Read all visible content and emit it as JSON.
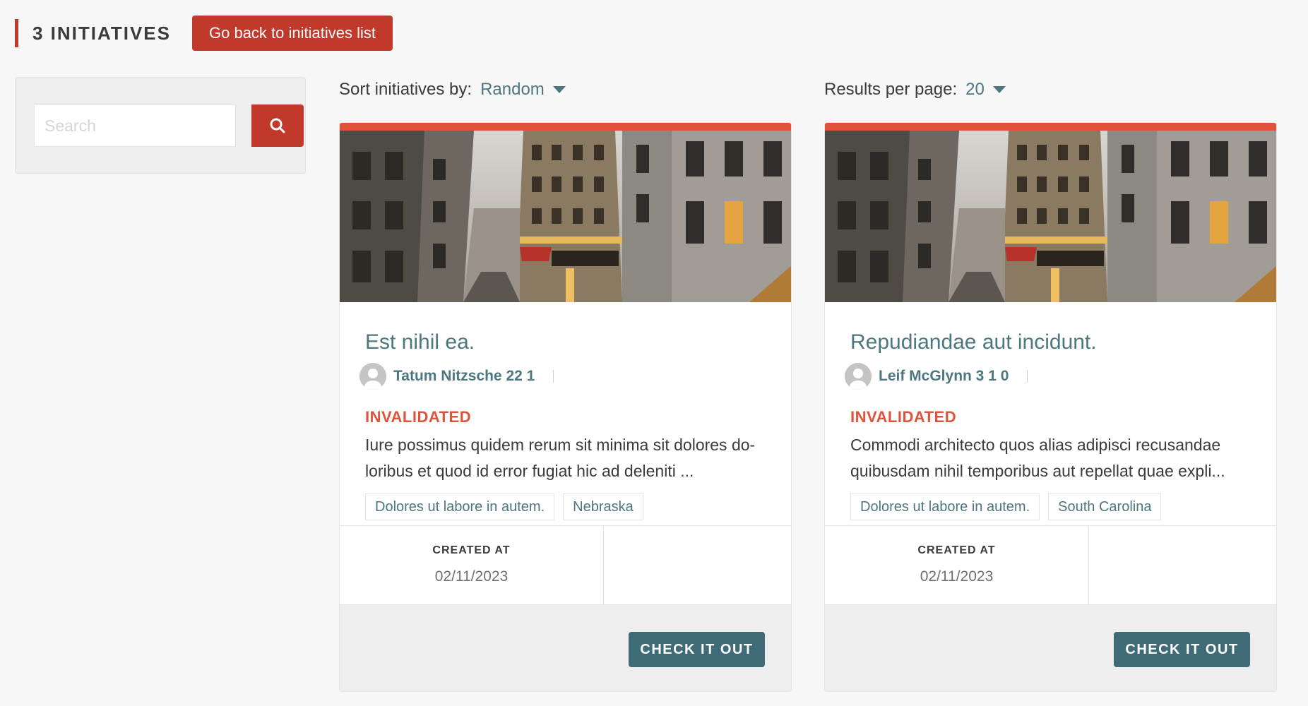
{
  "header": {
    "count_title": "3 INITIATIVES",
    "back_button": "Go back to initiatives list"
  },
  "filters": {
    "search_placeholder": "Search"
  },
  "sort": {
    "label": "Sort initiatives by:",
    "value": "Random"
  },
  "per_page": {
    "label": "Results per page:",
    "value": "20"
  },
  "colors": {
    "accent": "#c0392b",
    "state": "#e0533a",
    "link": "#4c7680",
    "button": "#3f6b76"
  },
  "cards": [
    {
      "title": "Est nihil ea.",
      "author": "Tatum Nitzsche 22 1",
      "state": "INVALIDATED",
      "description": "Iure possimus quidem rerum sit minima sit dolores do-loribus et quod id error fugiat hic ad deleniti ...",
      "tags": [
        "Dolores ut labore in autem.",
        "Nebraska"
      ],
      "stat_label": "CREATED AT",
      "stat_value": "02/11/2023",
      "button": "CHECK IT OUT"
    },
    {
      "title": "Repudiandae aut incidunt.",
      "author": "Leif McGlynn 3 1 0",
      "state": "INVALIDATED",
      "description": "Commodi architecto quos alias adipisci recusandae quibusdam nihil temporibus aut repellat quae expli...",
      "tags": [
        "Dolores ut labore in autem.",
        "South Carolina"
      ],
      "stat_label": "CREATED AT",
      "stat_value": "02/11/2023",
      "button": "CHECK IT OUT"
    }
  ]
}
